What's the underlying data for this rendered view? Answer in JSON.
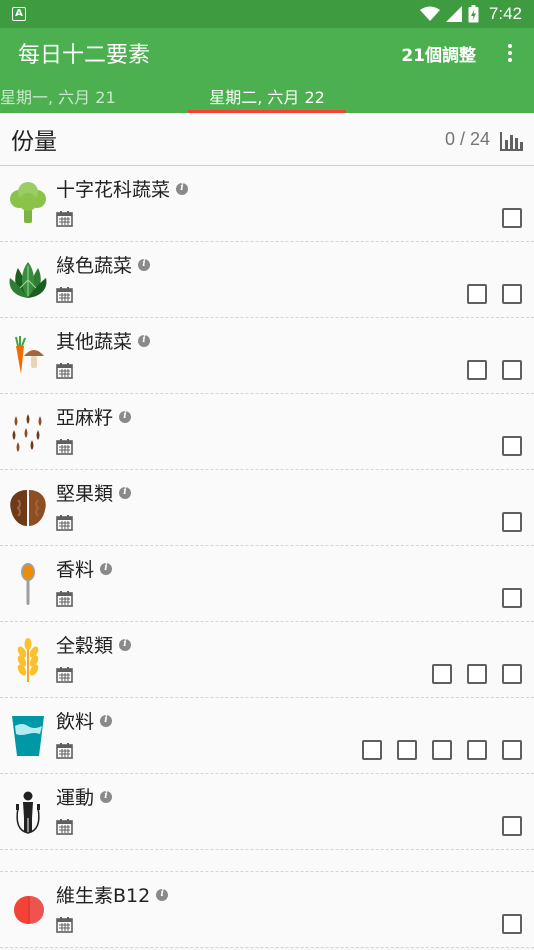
{
  "status": {
    "app_indicator": "A",
    "time": "7:42"
  },
  "app_bar": {
    "title": "每日十二要素",
    "adjust_label": "21個調整"
  },
  "date_tabs": {
    "previous": "星期一, 六月 21",
    "current": "星期二, 六月 22"
  },
  "servings": {
    "title": "份量",
    "count": "0 / 24"
  },
  "items": [
    {
      "name": "十字花科蔬菜",
      "icon": "broccoli-icon",
      "boxes": 1
    },
    {
      "name": "綠色蔬菜",
      "icon": "leafy-greens-icon",
      "boxes": 2
    },
    {
      "name": "其他蔬菜",
      "icon": "carrot-mushroom-icon",
      "boxes": 2
    },
    {
      "name": "亞麻籽",
      "icon": "flaxseed-icon",
      "boxes": 1
    },
    {
      "name": "堅果類",
      "icon": "walnut-icon",
      "boxes": 1
    },
    {
      "name": "香料",
      "icon": "spice-spoon-icon",
      "boxes": 1
    },
    {
      "name": "全穀類",
      "icon": "wheat-icon",
      "boxes": 3
    },
    {
      "name": "飲料",
      "icon": "drink-cup-icon",
      "boxes": 5
    },
    {
      "name": "運動",
      "icon": "jump-rope-icon",
      "boxes": 1
    },
    {
      "name": "維生素B12",
      "icon": "vitamin-pill-icon",
      "boxes": 1
    }
  ],
  "colors": {
    "primary": "#4caf50",
    "status_bar": "#3e9b40",
    "tab_indicator": "#f44336"
  }
}
